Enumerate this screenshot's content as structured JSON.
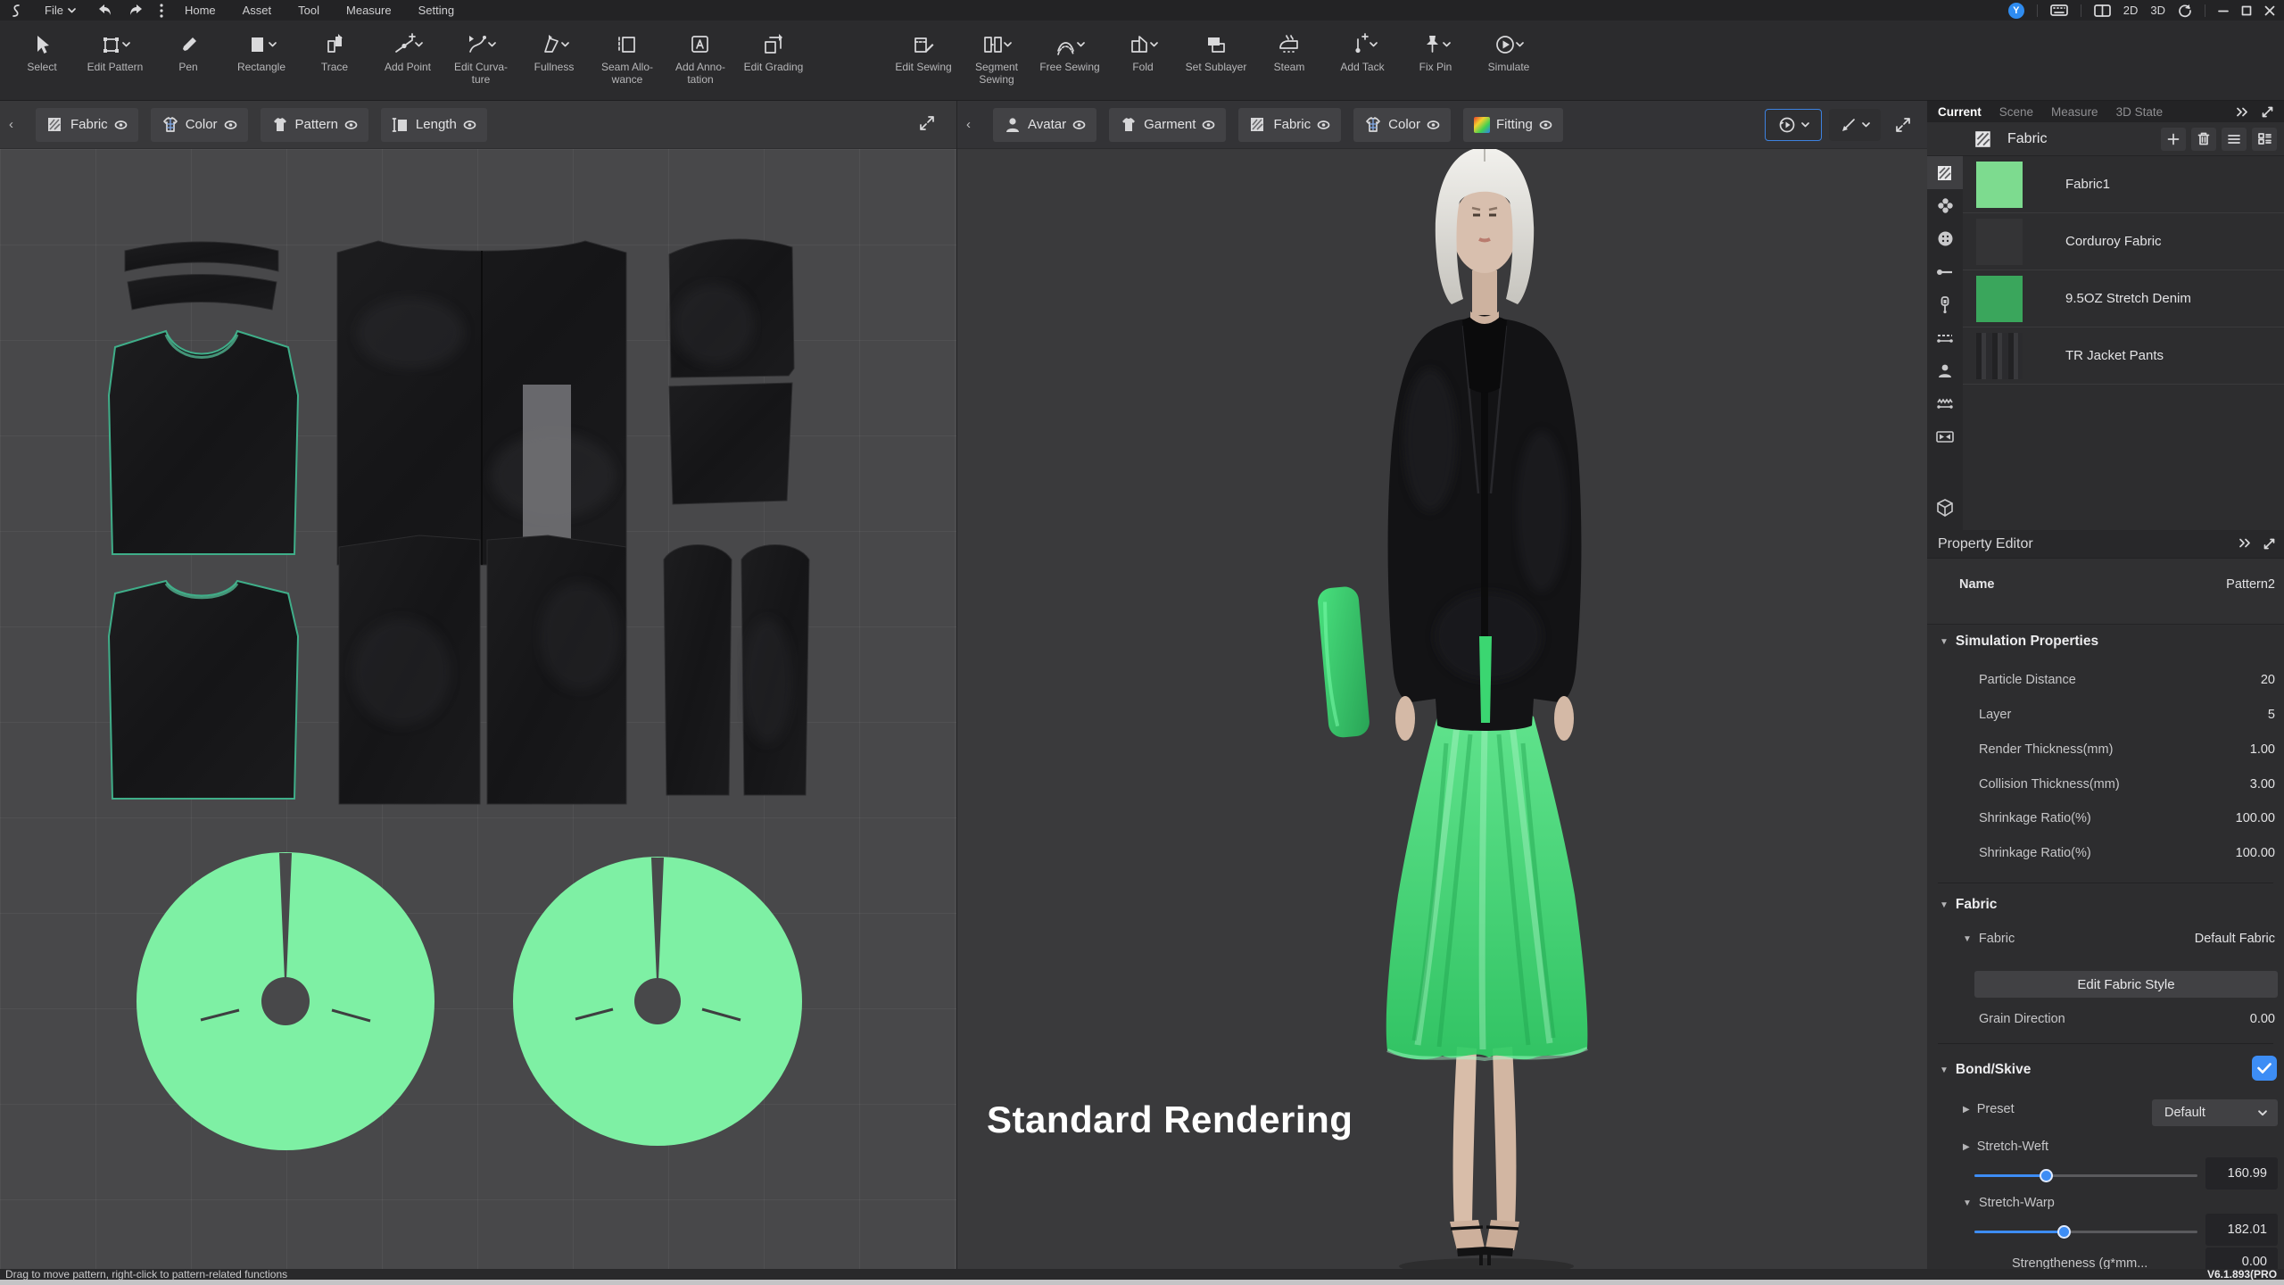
{
  "titlebar": {
    "logo": "S",
    "file_menu": "File",
    "nav": [
      {
        "label": "Home"
      },
      {
        "label": "Asset"
      },
      {
        "label": "Tool"
      },
      {
        "label": "Measure"
      },
      {
        "label": "Setting"
      }
    ],
    "user_initial": "Y",
    "mode_2d": "2D",
    "mode_3d": "3D"
  },
  "toolbar": {
    "groups": [
      {
        "items": [
          {
            "label": "Select",
            "icon": "cursor-icon"
          },
          {
            "label": "Edit Pattern",
            "icon": "edit-pattern-icon"
          },
          {
            "label": "Pen",
            "icon": "pen-icon"
          },
          {
            "label": "Rectangle",
            "icon": "rectangle-icon"
          },
          {
            "label": "Trace",
            "icon": "trace-icon"
          },
          {
            "label": "Add Point",
            "icon": "add-point-icon"
          },
          {
            "label": "Edit Curva-\nture",
            "icon": "edit-curvature-icon"
          },
          {
            "label": "Fullness",
            "icon": "fullness-icon"
          },
          {
            "label": "Seam Allo-\nwance",
            "icon": "seam-allowance-icon"
          },
          {
            "label": "Add Anno-\ntation",
            "icon": "add-annotation-icon"
          },
          {
            "label": "Edit Grading",
            "icon": "edit-grading-icon"
          }
        ]
      },
      {
        "items": [
          {
            "label": "Edit Sewing",
            "icon": "edit-sewing-icon"
          },
          {
            "label": "Segment\nSewing",
            "icon": "segment-sewing-icon"
          },
          {
            "label": "Free Sewing",
            "icon": "free-sewing-icon"
          },
          {
            "label": "Fold",
            "icon": "fold-icon"
          },
          {
            "label": "Set Sublayer",
            "icon": "set-sublayer-icon"
          },
          {
            "label": "Steam",
            "icon": "steam-icon"
          },
          {
            "label": "Add Tack",
            "icon": "add-tack-icon"
          },
          {
            "label": "Fix Pin",
            "icon": "fix-pin-icon"
          },
          {
            "label": "Simulate",
            "icon": "simulate-icon"
          }
        ]
      }
    ]
  },
  "panel2d": {
    "tabs": [
      {
        "label": "Fabric",
        "icon": "fabric-swatch-icon"
      },
      {
        "label": "Color",
        "icon": "color-icon"
      },
      {
        "label": "Pattern",
        "icon": "pattern-icon"
      },
      {
        "label": "Length",
        "icon": "length-icon"
      }
    ]
  },
  "panel3d": {
    "tabs": [
      {
        "label": "Avatar",
        "icon": "avatar-icon"
      },
      {
        "label": "Garment",
        "icon": "garment-icon"
      },
      {
        "label": "Fabric",
        "icon": "fabric-swatch-icon"
      },
      {
        "label": "Color",
        "icon": "color-icon"
      },
      {
        "label": "Fitting",
        "icon": "fitting-icon"
      }
    ],
    "overlay_label": "Standard Rendering"
  },
  "right_panel": {
    "tabs": [
      {
        "label": "Current"
      },
      {
        "label": "Scene"
      },
      {
        "label": "Measure"
      },
      {
        "label": "3D State"
      }
    ],
    "browser": {
      "title": "Fabric",
      "items": [
        {
          "name": "Fabric1",
          "swatch_color": "#7ddb8f"
        },
        {
          "name": "Corduroy Fabric",
          "swatch_color": "#343436"
        },
        {
          "name": "9.5OZ Stretch Denim",
          "swatch_color": "#3aa65c"
        },
        {
          "name": "TR Jacket Pants",
          "swatch_color": "#2b2b2d"
        }
      ]
    },
    "property_editor": {
      "title": "Property Editor",
      "name_label": "Name",
      "name_value": "Pattern2",
      "simulation": {
        "title": "Simulation Properties",
        "rows": [
          {
            "label": "Particle Distance",
            "value": "20"
          },
          {
            "label": "Layer",
            "value": "5"
          },
          {
            "label": "Render Thickness(mm)",
            "value": "1.00"
          },
          {
            "label": "Collision Thickness(mm)",
            "value": "3.00"
          },
          {
            "label": "Shrinkage Ratio(%)",
            "value": "100.00"
          },
          {
            "label": "Shrinkage Ratio(%)",
            "value": "100.00"
          }
        ]
      },
      "fabric_section": {
        "title": "Fabric",
        "sub_label": "Fabric",
        "sub_value": "Default Fabric",
        "edit_button": "Edit  Fabric Style",
        "grain_label": "Grain Direction",
        "grain_value": "0.00"
      },
      "bond": {
        "title": "Bond/Skive",
        "preset_label": "Preset",
        "preset_value": "Default",
        "weft_label": "Stretch-Weft",
        "weft_value": "160.99",
        "weft_pct": 32,
        "warp_label": "Stretch-Warp",
        "warp_value": "182.01",
        "warp_pct": 40,
        "strength_label": "Strengtheness (g*mm...",
        "strength_value": "0.00"
      }
    }
  },
  "statusbar": {
    "hint": "Drag to move pattern, right-click to pattern-related functions",
    "version": "V6.1.893(PRO"
  },
  "colors": {
    "accent_blue": "#3d8df5",
    "pattern_green": "#7ef0a4",
    "denim_green": "#3aa65c",
    "fabric1_green": "#7ddb8f"
  }
}
